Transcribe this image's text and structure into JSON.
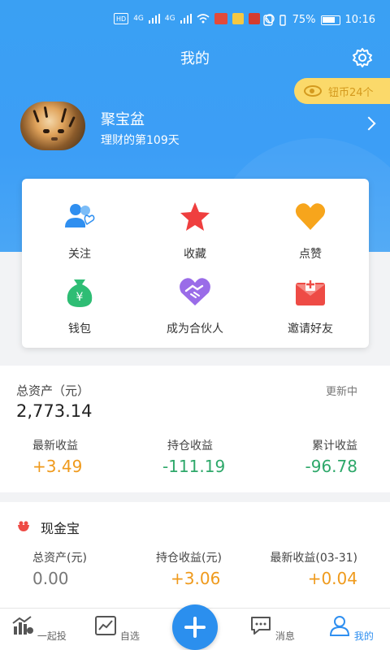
{
  "status_bar": {
    "network_labels": [
      "HD",
      "4G",
      "4G"
    ],
    "battery": "75%",
    "time": "10:16"
  },
  "header": {
    "title": "我的",
    "settings_icon": "gear-icon"
  },
  "profile": {
    "coin_badge": "钮币24个",
    "username": "聚宝盆",
    "days_text": "理财的第109天"
  },
  "quick_grid": [
    {
      "label": "关注",
      "icon": "users-follow-icon",
      "color": "#2f8ff0"
    },
    {
      "label": "收藏",
      "icon": "star-icon",
      "color": "#ef3f3f"
    },
    {
      "label": "点赞",
      "icon": "heart-icon",
      "color": "#f7a51c"
    },
    {
      "label": "钱包",
      "icon": "wallet-icon",
      "color": "#2ebd74"
    },
    {
      "label": "成为合伙人",
      "icon": "handshake-icon",
      "color": "#9a6ce8"
    },
    {
      "label": "邀请好友",
      "icon": "invite-envelope-icon",
      "color": "#ee4b45"
    }
  ],
  "assets": {
    "title": "总资产（元）",
    "update_status": "更新中",
    "total": "2,773.14",
    "metrics": [
      {
        "label": "最新收益",
        "value": "+3.49"
      },
      {
        "label": "持仓收益",
        "value": "-111.19"
      },
      {
        "label": "累计收益",
        "value": "-96.78"
      }
    ]
  },
  "cash": {
    "title": "现金宝",
    "metrics": [
      {
        "label": "总资产(元)",
        "value": "0.00"
      },
      {
        "label": "持仓收益(元)",
        "value": "+3.06"
      },
      {
        "label": "最新收益(03-31)",
        "value": "+0.04"
      }
    ]
  },
  "bottom_nav": [
    {
      "label": "一起投",
      "icon": "chart-bars-icon"
    },
    {
      "label": "自选",
      "icon": "trend-line-icon"
    },
    {
      "label": "",
      "icon": "plus-icon"
    },
    {
      "label": "消息",
      "icon": "message-icon"
    },
    {
      "label": "我的",
      "icon": "profile-icon",
      "active": true
    }
  ]
}
